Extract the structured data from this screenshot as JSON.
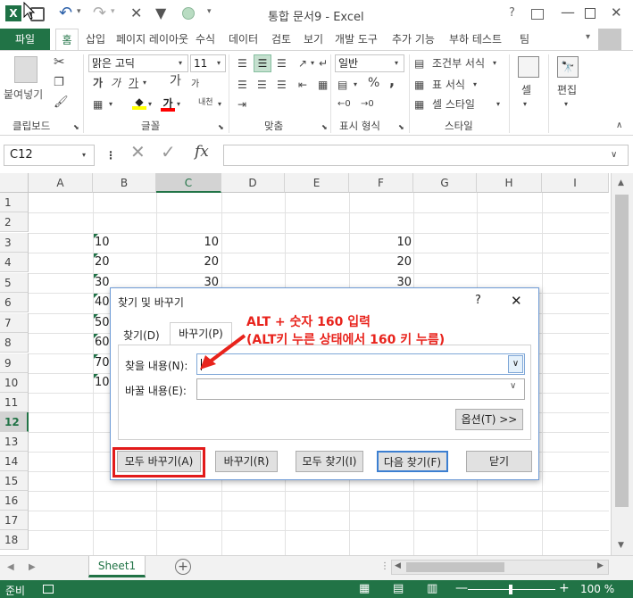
{
  "app": {
    "title": "통합 문서9 - Excel",
    "help": "?"
  },
  "tabs": [
    {
      "label": "파일"
    },
    {
      "label": "홈"
    },
    {
      "label": "삽입"
    },
    {
      "label": "페이지 레이아웃"
    },
    {
      "label": "수식"
    },
    {
      "label": "데이터"
    },
    {
      "label": "검토"
    },
    {
      "label": "보기"
    },
    {
      "label": "개발 도구"
    },
    {
      "label": "추가 기능"
    },
    {
      "label": "부하 테스트"
    },
    {
      "label": "팀"
    }
  ],
  "ribbon": {
    "paste_label": "붙여넣기",
    "clipboard": "클립보드",
    "font_name": "맑은 고딕",
    "font_size": "11",
    "font_group": "글꼴",
    "align_group": "맞춤",
    "number_format": "일반",
    "number_group": "표시 형식",
    "conditional": "조건부 서식",
    "table_format": "표 서식",
    "cell_style": "셀 스타일",
    "style_group": "스타일",
    "cells_label": "셀",
    "edit_label": "편집",
    "bold": "가",
    "italic": "가",
    "underline": "가",
    "grow": "가",
    "shrink": "가",
    "phonetic": "내천",
    "percent": "%",
    "comma": ","
  },
  "formula": {
    "namebox": "C12",
    "fx": "fx",
    "value": ""
  },
  "grid": {
    "columns": [
      "A",
      "B",
      "C",
      "D",
      "E",
      "F",
      "G",
      "H",
      "I"
    ],
    "rows": [
      "1",
      "2",
      "3",
      "4",
      "5",
      "6",
      "7",
      "8",
      "9",
      "10",
      "11",
      "12",
      "13",
      "14",
      "15",
      "16",
      "17",
      "18"
    ],
    "cells": {
      "B3": "10",
      "B4": "20",
      "B5": "30",
      "B6": "40",
      "B7": "50",
      "B8": "60",
      "B9": "70",
      "B10": "100",
      "C3": "10",
      "C4": "20",
      "C5": "30",
      "F3": "10",
      "F4": "20",
      "F5": "30"
    }
  },
  "dialog": {
    "title": "찾기 및 바꾸기",
    "help": "?",
    "close": "✕",
    "tab_find": "찾기(D)",
    "tab_replace": "바꾸기(P)",
    "find_label": "찾을 내용(N):",
    "replace_label": "바꿀 내용(E):",
    "find_value": "",
    "replace_value": "",
    "options_btn": "옵션(T) >>",
    "replace_all_btn": "모두 바꾸기(A)",
    "replace_btn": "바꾸기(R)",
    "find_all_btn": "모두 찾기(I)",
    "find_next_btn": "다음 찾기(F)",
    "close_btn": "닫기"
  },
  "annotation": {
    "line1": "ALT + 숫자 160 입력",
    "line2": "(ALT키 누른 상태에서 160 키 누름)",
    "color": "#e8231c"
  },
  "sheets": [
    {
      "label": "Sheet1"
    }
  ],
  "status": {
    "ready": "준비",
    "zoom": "100 %"
  },
  "colors": {
    "excel_green": "#217346",
    "selected_header": "#1e7145",
    "highlight": "#e21a1a"
  }
}
